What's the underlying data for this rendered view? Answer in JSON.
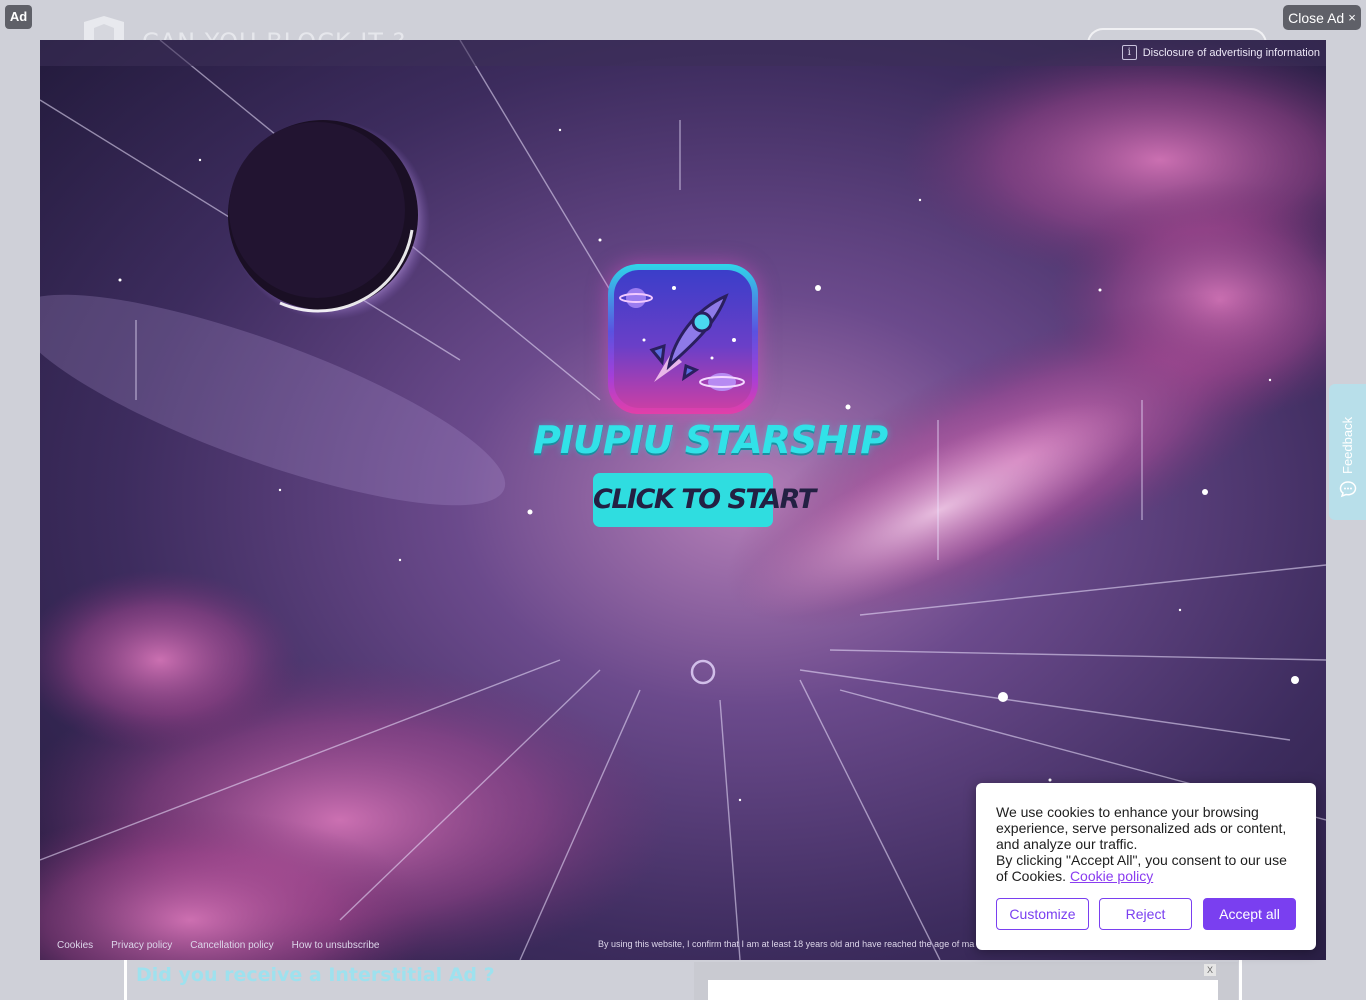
{
  "background_page": {
    "site_title": "CAN YOU BLOCK IT ?",
    "article_heading": "Did you receive a Interstitial Ad ?",
    "ad_slot_close": "X"
  },
  "ad_badge": "Ad",
  "close_ad": {
    "label": "Close Ad",
    "icon": "×"
  },
  "feedback": {
    "label": "Feedback",
    "icon": "chat-bubble-icon"
  },
  "interstitial": {
    "disclosure": {
      "icon": "i",
      "text": "Disclosure of advertising information"
    },
    "game_title": "PIUPIU STARSHIP",
    "start_button": "CLICK TO START",
    "footer_links": [
      "Cookies",
      "Privacy policy",
      "Cancellation policy",
      "How to unsubscribe"
    ],
    "age_notice": "By using this website, I confirm that I am at least 18 years old and have reached the age of ma"
  },
  "cookie_banner": {
    "text_1": "We use cookies to enhance your browsing experience, serve personalized ads or content, and analyze our traffic.",
    "text_2": "By clicking \"Accept All\", you consent to our use of Cookies.",
    "policy_link": "Cookie policy",
    "customize_label": "Customize",
    "reject_label": "Reject",
    "accept_label": "Accept all",
    "accent_color": "#7a3ff0"
  }
}
